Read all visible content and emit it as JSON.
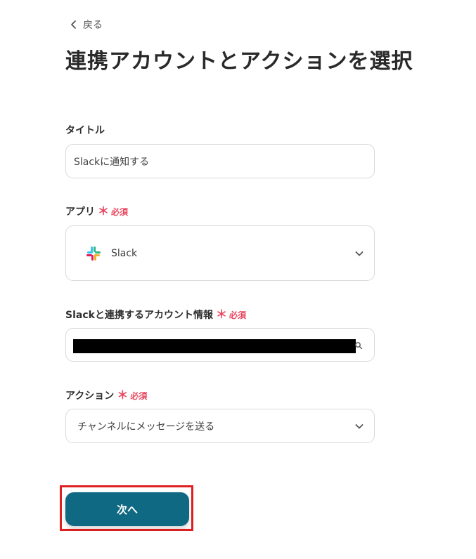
{
  "header": {
    "back_label": "戻る",
    "title": "連携アカウントとアクションを選択"
  },
  "form": {
    "title_field": {
      "label": "タイトル",
      "value": "Slackに通知する"
    },
    "app_field": {
      "label": "アプリ",
      "required": "必須",
      "required_mark": "＊",
      "value": "Slack",
      "icon": "slack-logo"
    },
    "account_field": {
      "label": "Slackと連携するアカウント情報",
      "required": "必須",
      "required_mark": "＊"
    },
    "action_field": {
      "label": "アクション",
      "required": "必須",
      "required_mark": "＊",
      "value": "チャンネルにメッセージを送る"
    }
  },
  "footer": {
    "next_label": "次へ"
  },
  "colors": {
    "primary": "#106983",
    "required": "#e8465f",
    "highlight": "#e02020"
  }
}
